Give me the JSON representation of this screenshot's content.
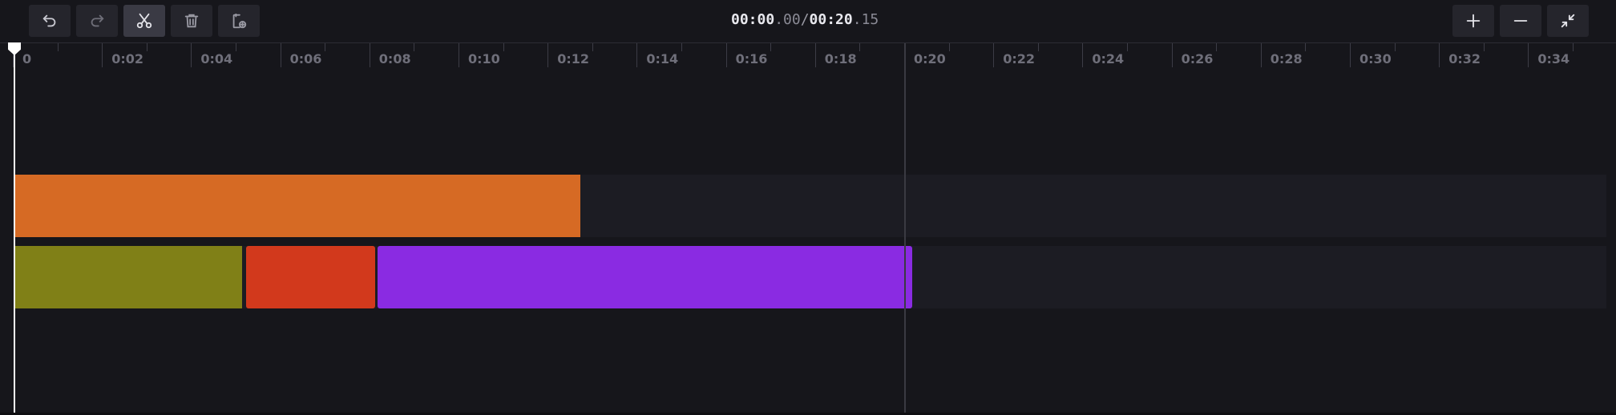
{
  "toolbar": {
    "buttons": [
      "undo-icon",
      "redo-icon",
      "scissors-icon",
      "trash-icon",
      "clipboard-add-icon"
    ],
    "zoom_buttons": [
      "plus-icon",
      "minus-icon",
      "collapse-icon"
    ]
  },
  "timecode": {
    "current_main": "00:00",
    "current_frac": ".00",
    "separator": "/",
    "total_main": "00:20",
    "total_frac": ".15"
  },
  "ruler": {
    "labels": [
      "0",
      "0:02",
      "0:04",
      "0:06",
      "0:08",
      "0:10",
      "0:12",
      "0:14",
      "0:16",
      "0:18",
      "0:20",
      "0:22",
      "0:24",
      "0:26",
      "0:28",
      "0:30",
      "0:32",
      "0:34"
    ]
  },
  "tracks": [
    {
      "clips": [
        {
          "color": "#d66a24",
          "start": 0,
          "end": 12.7
        }
      ]
    },
    {
      "clips": [
        {
          "color": "#808017",
          "start": 0,
          "end": 5.1
        },
        {
          "color": "#d2391c",
          "start": 5.2,
          "end": 8.1
        },
        {
          "color": "#8a2be2",
          "start": 8.15,
          "end": 20.15
        }
      ]
    }
  ],
  "colors": {
    "background": "#16161b",
    "track": "#1c1c23",
    "playhead": "#ffffff"
  }
}
